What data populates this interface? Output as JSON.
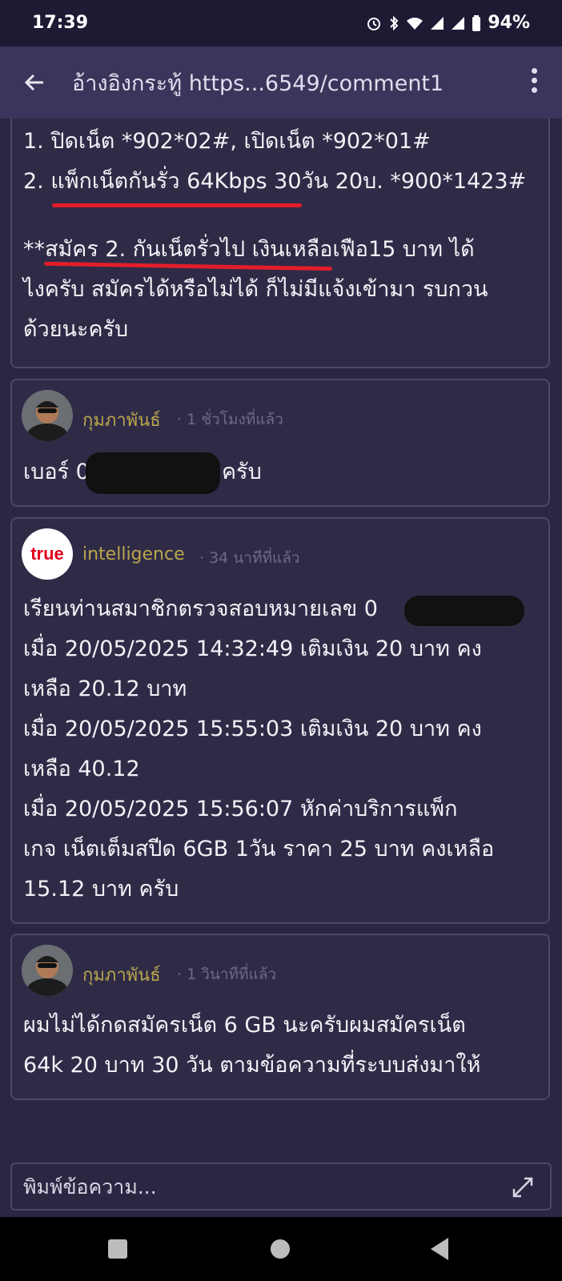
{
  "status": {
    "time": "17:39",
    "battery": "94%"
  },
  "app_bar": {
    "title": "อ้างอิงกระทู้ https...6549/comment1"
  },
  "posts": [
    {
      "lines": [
        "1. ปิดเน็ต *902*02#, เปิดเน็ต *902*01#",
        "2. แพ็กเน็ตกันรั่ว 64Kbps 30วัน 20บ. *900*1423#",
        "",
        "**สมัคร 2. กันเน็ตรั่วไป เงินเหลือเฟือ15 บาท ได้",
        "ไงครับ สมัครได้หรือไม่ได้ ก็ไม่มีแจ้งเข้ามา รบกวน",
        "ด้วยนะครับ"
      ]
    },
    {
      "author": "กุมภาพันธ์",
      "time": "· 1 ชั่วโมงที่แล้ว",
      "text_start": "เบอร์ 0",
      "text_end": "ครับ"
    },
    {
      "author": "intelligence",
      "time": "· 34 นาทีที่แล้ว",
      "avatar_text": "true",
      "lines": [
        "เรียนท่านสมาชิกตรวจสอบหมายเลข 0",
        "เมื่อ 20/05/2025 14:32:49  เติมเงิน 20 บาท คง",
        "เหลือ 20.12 บาท",
        "เมื่อ 20/05/2025 15:55:03 เติมเงิน 20 บาท คง",
        "เหลือ 40.12",
        "เมื่อ 20/05/2025 15:56:07 หักค่าบริการแพ็ก",
        "เกจ เน็ตเต็มสปีด 6GB 1วัน ราคา 25 บาท คงเหลือ",
        "15.12 บาท ครับ"
      ]
    },
    {
      "author": "กุมภาพันธ์",
      "time": "· 1 วินาทีที่แล้ว",
      "lines": [
        "ผมไม่ได้กดสมัครเน็ต 6 GB นะครับผมสมัครเน็ต",
        "64k 20 บาท 30 วัน ตามข้อความที่ระบบส่งมาให้"
      ]
    }
  ],
  "composer": {
    "placeholder": "พิมพ์ข้อความ..."
  },
  "colors": {
    "background": "#2b2742",
    "card": "#2f2b47",
    "app_bar": "#3a355a",
    "author": "#b9a64c",
    "underline": "#e21e2a"
  }
}
